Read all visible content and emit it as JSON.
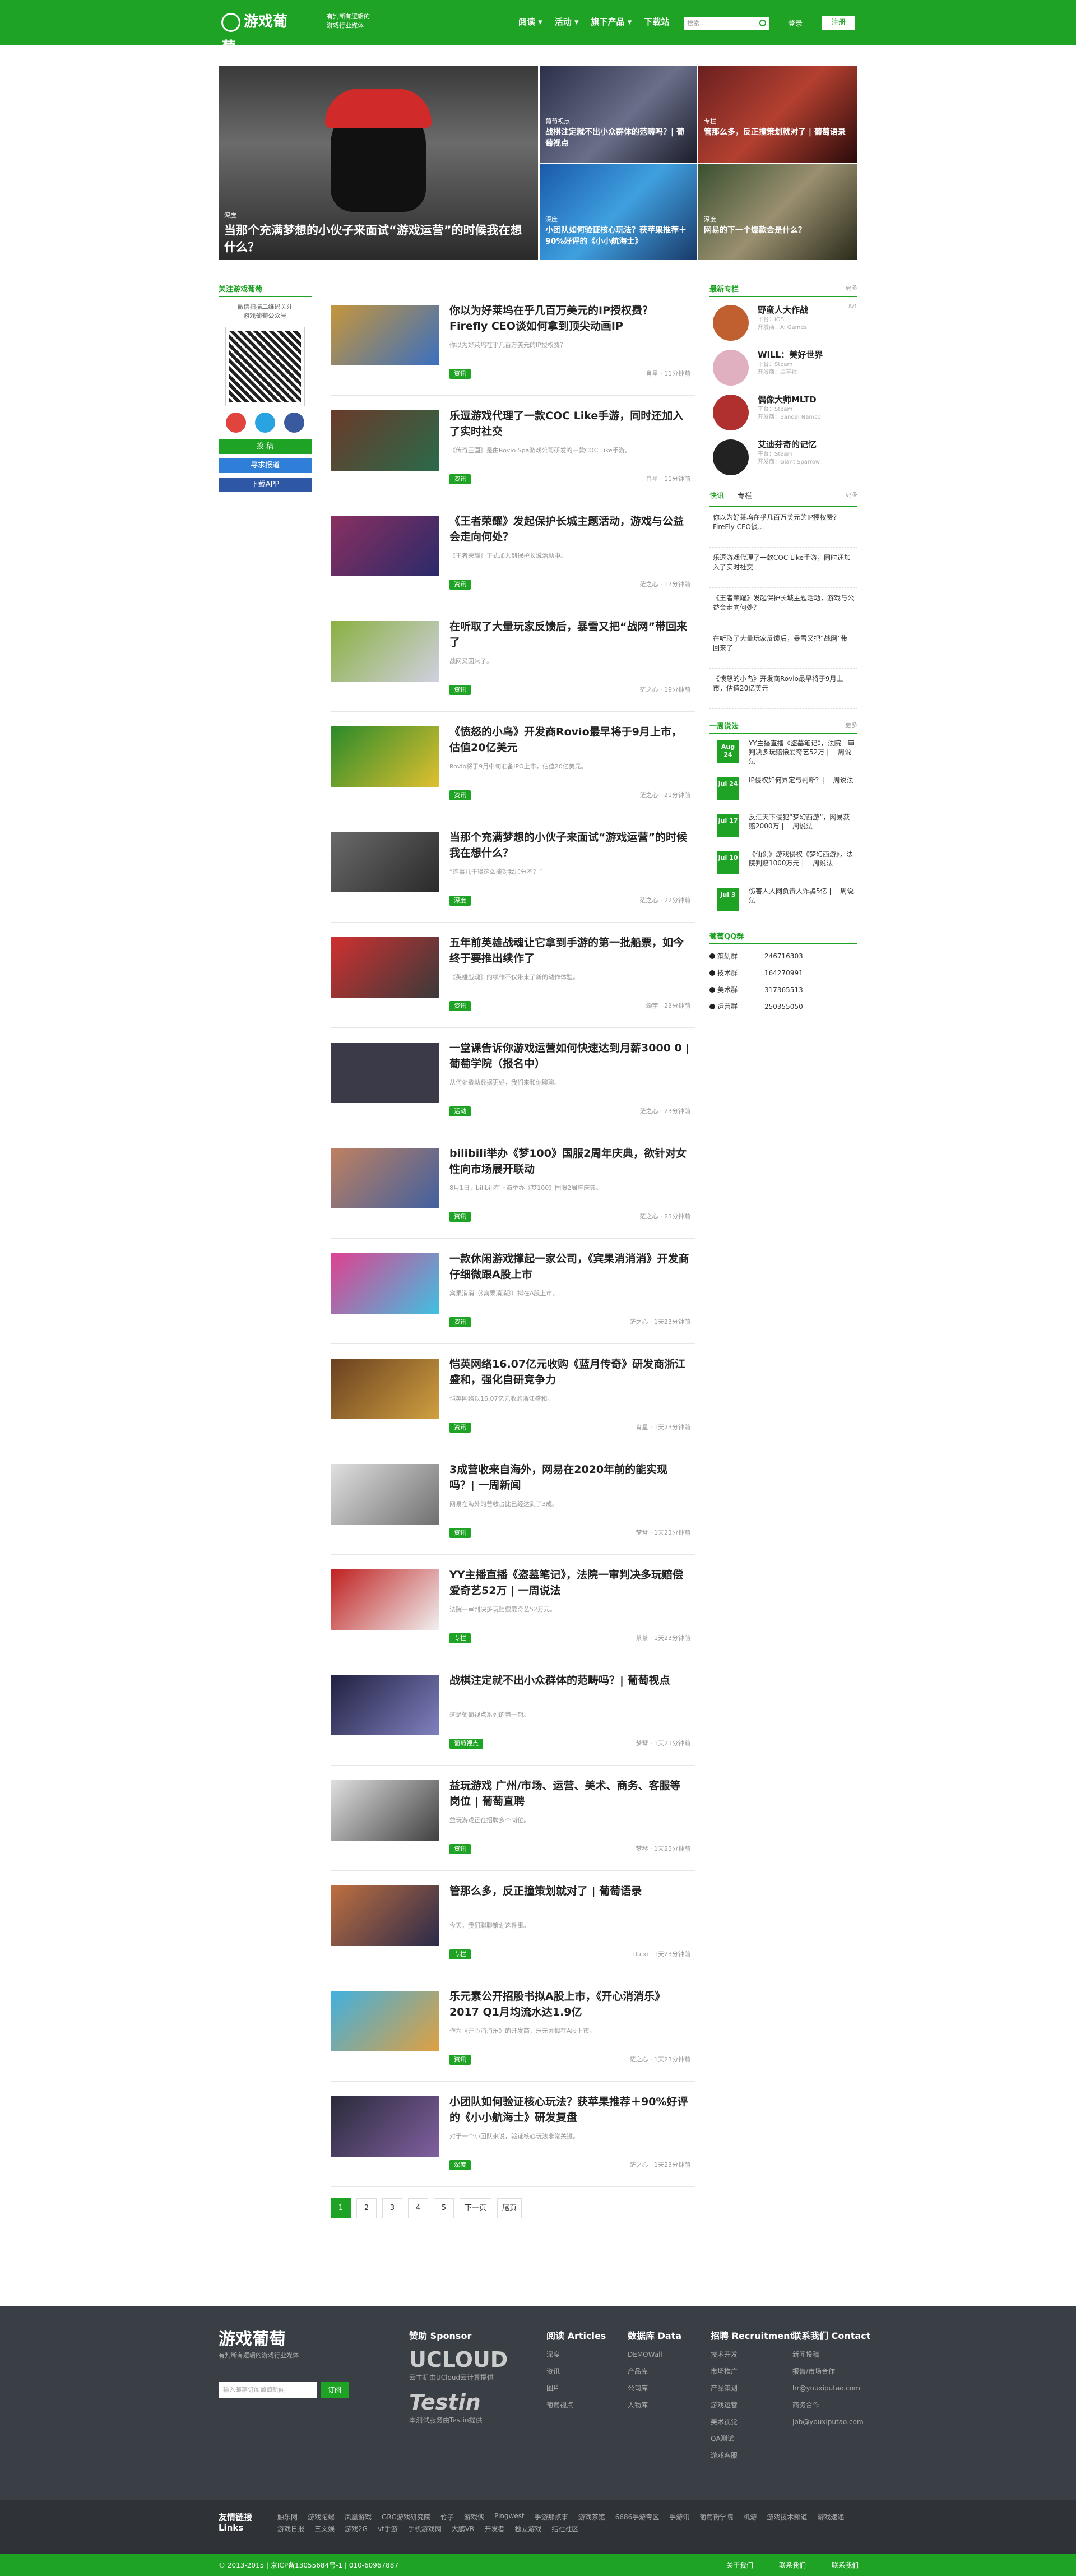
{
  "header": {
    "logo": "游戏葡萄",
    "slogan": [
      "有判断有逻辑的",
      "游戏行业媒体"
    ],
    "nav": [
      "阅读 ▾",
      "活动 ▾",
      "旗下产品 ▾",
      "下载站"
    ],
    "search_placeholder": "搜索...",
    "login": "登录",
    "register": "注册"
  },
  "hero": [
    {
      "label": "深度",
      "title": "当那个充满梦想的小伙子来面试“游戏运营”的时候我在想什么？"
    },
    {
      "label": "葡萄视点",
      "title": "战棋注定就不出小众群体的范畴吗？| 葡萄视点"
    },
    {
      "label": "专栏",
      "title": "管那么多，反正撞策划就对了 | 葡萄语录"
    },
    {
      "label": "深度",
      "title": "小团队如何验证核心玩法？获苹果推荐＋90%好评的《小小航海士》"
    },
    {
      "label": "深度",
      "title": "网易的下一个爆款会是什么？"
    }
  ],
  "left": {
    "heading": "关注游戏葡萄",
    "qr_caption": [
      "微信扫描二维码关注",
      "游戏葡萄公众号"
    ],
    "buttons": [
      "投  稿",
      "寻求报道",
      "下载APP"
    ]
  },
  "articles": [
    {
      "title": "你以为好莱坞在乎几百万美元的IP授权费？Firefly CEO谈如何拿到顶尖动画IP",
      "summary": "你以为好莱坞在乎几百万美元的IP授权费？",
      "tag": "资讯",
      "meta": "肖星 · 11分钟前"
    },
    {
      "title": "乐逗游戏代理了一款COC Like手游，同时还加入了实时社交",
      "summary": "《传奇王国》是由Rovio Spa游戏公司研发的一款COC Like手游。",
      "tag": "资讯",
      "meta": "肖星 · 11分钟前"
    },
    {
      "title": "《王者荣耀》发起保护长城主题活动，游戏与公益会走向何处？",
      "summary": "《王者荣耀》正式加入到保护长城活动中。",
      "tag": "资讯",
      "meta": "茫之心 · 17分钟前"
    },
    {
      "title": "在听取了大量玩家反馈后，暴雪又把“战网”带回来了",
      "summary": "战网又回来了。",
      "tag": "资讯",
      "meta": "茫之心 · 19分钟前"
    },
    {
      "title": "《愤怒的小鸟》开发商Rovio最早将于9月上市，估值20亿美元",
      "summary": "Rovio将于9月中旬准备IPO上市，估值20亿美元。",
      "tag": "资讯",
      "meta": "茫之心 · 21分钟前"
    },
    {
      "title": "当那个充满梦想的小伙子来面试“游戏运营”的时候我在想什么？",
      "summary": "“这事儿干得这么能对我加分不？”",
      "tag": "深度",
      "meta": "茫之心 · 22分钟前"
    },
    {
      "title": "五年前英雄战魂让它拿到手游的第一批船票，如今终于要推出续作了",
      "summary": "《英雄战魂》的续作不仅带来了新的动作体验。",
      "tag": "资讯",
      "meta": "灏宇 · 23分钟前"
    },
    {
      "title": "一堂课告诉你游戏运营如何快速达到月薪3000 0 | 葡萄学院（报名中）",
      "summary": "从何处撬动数据更好，我们来和你聊聊。",
      "tag": "活动",
      "meta": "茫之心 · 23分钟前"
    },
    {
      "title": "bilibili举办《梦100》国服2周年庆典，欲针对女性向市场展开联动",
      "summary": "8月1日，bilibili在上海举办《梦100》国服2周年庆典。",
      "tag": "资讯",
      "meta": "茫之心 · 23分钟前"
    },
    {
      "title": "一款休闲游戏撑起一家公司，《宾果消消消》开发商仔细微跟A股上市",
      "summary": "宾果消消（《宾果消消》）拟在A股上市。",
      "tag": "资讯",
      "meta": "茫之心 · 1天23分钟前"
    },
    {
      "title": "恺英网络16.07亿元收购《蓝月传奇》研发商浙江盛和，强化自研竞争力",
      "summary": "恺英网络以16.07亿元收购浙江盛和。",
      "tag": "资讯",
      "meta": "肖星 · 1天23分钟前"
    },
    {
      "title": "3成营收来自海外，网易在2020年前的能实现吗？| 一周新闻",
      "summary": "网易在海外的营收占比已经达到了3成。",
      "tag": "资讯",
      "meta": "梦琴 · 1天23分钟前"
    },
    {
      "title": "YY主播直播《盗墓笔记》，法院一审判决多玩赔偿爱奇艺52万 | 一周说法",
      "summary": "法院一审判决多玩赔偿爱奇艺52万元。",
      "tag": "专栏",
      "meta": "茶茶 · 1天23分钟前"
    },
    {
      "title": "战棋注定就不出小众群体的范畴吗？| 葡萄视点",
      "summary": "这是葡萄视点系列的第一期。",
      "tag": "葡萄视点",
      "meta": "梦琴 · 1天23分钟前"
    },
    {
      "title": "益玩游戏 广州/市场、运营、美术、商务、客服等岗位 | 葡萄直聘",
      "summary": "益玩游戏正在招聘多个岗位。",
      "tag": "资讯",
      "meta": "梦琴 · 1天23分钟前"
    },
    {
      "title": "管那么多，反正撞策划就对了 | 葡萄语录",
      "summary": "今天，我们聊聊策划这件事。",
      "tag": "专栏",
      "meta": "Ruixi · 1天23分钟前"
    },
    {
      "title": "乐元素公开招股书拟A股上市，《开心消消乐》2017 Q1月均流水达1.9亿",
      "summary": "作为《开心消消乐》的开发商，乐元素拟在A股上市。",
      "tag": "资讯",
      "meta": "茫之心 · 1天23分钟前"
    },
    {
      "title": "小团队如何验证核心玩法？获苹果推荐＋90%好评的《小小航海士》研发复盘",
      "summary": "对于一个小团队来说，验证核心玩法非常关键。",
      "tag": "深度",
      "meta": "茫之心 · 1天23分钟前"
    }
  ],
  "pager": [
    "1",
    "2",
    "3",
    "4",
    "5",
    "下一页",
    "尾页"
  ],
  "right": {
    "people_heading": "最新专栏",
    "people_more": "更多",
    "people": [
      {
        "name": "野蛮人大作战",
        "s1": "平台：iOS",
        "s2": "开发商：Ai Games",
        "date": "8/1"
      },
      {
        "name": "WILL：美好世界",
        "s1": "平台：Steam",
        "s2": "开发商：兰亭社",
        "date": ""
      },
      {
        "name": "偶像大师MLTD",
        "s1": "平台：Steam",
        "s2": "开发商：Bandai Namco",
        "date": ""
      },
      {
        "name": "艾迪芬奇的记忆",
        "s1": "平台：Steam",
        "s2": "开发商：Giant Sparrow",
        "date": ""
      }
    ],
    "tabs": [
      "快讯",
      "专栏"
    ],
    "tabs_more": "更多",
    "quick": [
      "你以为好莱坞在乎几百万美元的IP授权费？FireFly CEO谈...",
      "乐逗游戏代理了一款COC Like手游，同时还加入了实时社交",
      "《王者荣耀》发起保护长城主题活动，游戏与公益会走向何处？",
      "在听取了大量玩家反馈后，暴雪又把“战网”带回来了",
      "《愤怒的小鸟》开发商Rovio最早将于9月上市，估值20亿美元"
    ],
    "law_heading": "一周说法",
    "law_more": "更多",
    "law": [
      {
        "date": "Aug 24",
        "title": "YY主播直播《盗墓笔记》，法院一审判决多玩赔偿爱奇艺52万 | 一周说法"
      },
      {
        "date": "Jul 24",
        "title": "IP侵权如何界定与判断？| 一周说法"
      },
      {
        "date": "Jul 17",
        "title": "反汇天下侵犯“梦幻西游”，网易获赔2000万 | 一周说法"
      },
      {
        "date": "Jul 10",
        "title": "《仙剑》游戏侵权《梦幻西游》，法院判赔1000万元 | 一周说法"
      },
      {
        "date": "Jul 3",
        "title": "伤害人人网负责人诈骗5亿 | 一周说法"
      }
    ],
    "qq_heading": "葡萄QQ群",
    "qq": [
      {
        "name": "策划群",
        "num": "246716303"
      },
      {
        "name": "技术群",
        "num": "164270991"
      },
      {
        "name": "美术群",
        "num": "317365513"
      },
      {
        "name": "运营群",
        "num": "250355050"
      }
    ]
  },
  "footer": {
    "logo": "游戏葡萄",
    "tagline": "有判断有逻辑的游戏行业媒体",
    "subscribe_placeholder": "输入邮箱订阅葡萄新闻",
    "subscribe_btn": "订阅",
    "sponsor_h": "赞助 Sponsor",
    "sponsor_names": [
      "UCLOUD",
      "Testin"
    ],
    "sponsor_captions": [
      "云主机由UCloud云计算提供",
      "本测试服务由Testin提供"
    ],
    "articles_h": "阅读 Articles",
    "articles": [
      "深度",
      "资讯",
      "图片",
      "葡萄视点"
    ],
    "data_h": "数据库 Data",
    "data": [
      "DEMOWall",
      "产品库",
      "公司库",
      "人物库"
    ],
    "recruit_h": "招聘 Recruitment",
    "recruit": [
      "技术开发",
      "市场推广",
      "产品策划",
      "游戏运营",
      "美术视觉",
      "QA测试",
      "游戏客服"
    ],
    "contact_h": "联系我们 Contact",
    "contact": [
      "新闻投稿",
      "报告/市场合作",
      "hr@youxiputao.com",
      "商务合作",
      "job@youxiputao.com"
    ],
    "links_h": "友情链接 Links",
    "links": [
      "触乐网",
      "游戏陀螺",
      "凤凰游戏",
      "GRG游戏研究院",
      "竹子",
      "游戏侠",
      "Pingwest",
      "手游那点事",
      "游戏茶馆",
      "6686手游专区",
      "手游讯",
      "葡萄街学院",
      "机游",
      "游戏技术频道",
      "游戏速递",
      "游戏日报",
      "三文娱",
      "游戏2G",
      "vt手游",
      "手机游戏网",
      "大鹏VR",
      "开发者",
      "独立游戏",
      "结社社区"
    ],
    "copyright": "© 2013-2015 | 京ICP备13055684号-1 | 010-60967887",
    "bottom_links": [
      "关于我们",
      "联系我们",
      "联系我们"
    ]
  },
  "colors": {
    "brand": "#1ea324",
    "footer": "#3a3f45"
  }
}
